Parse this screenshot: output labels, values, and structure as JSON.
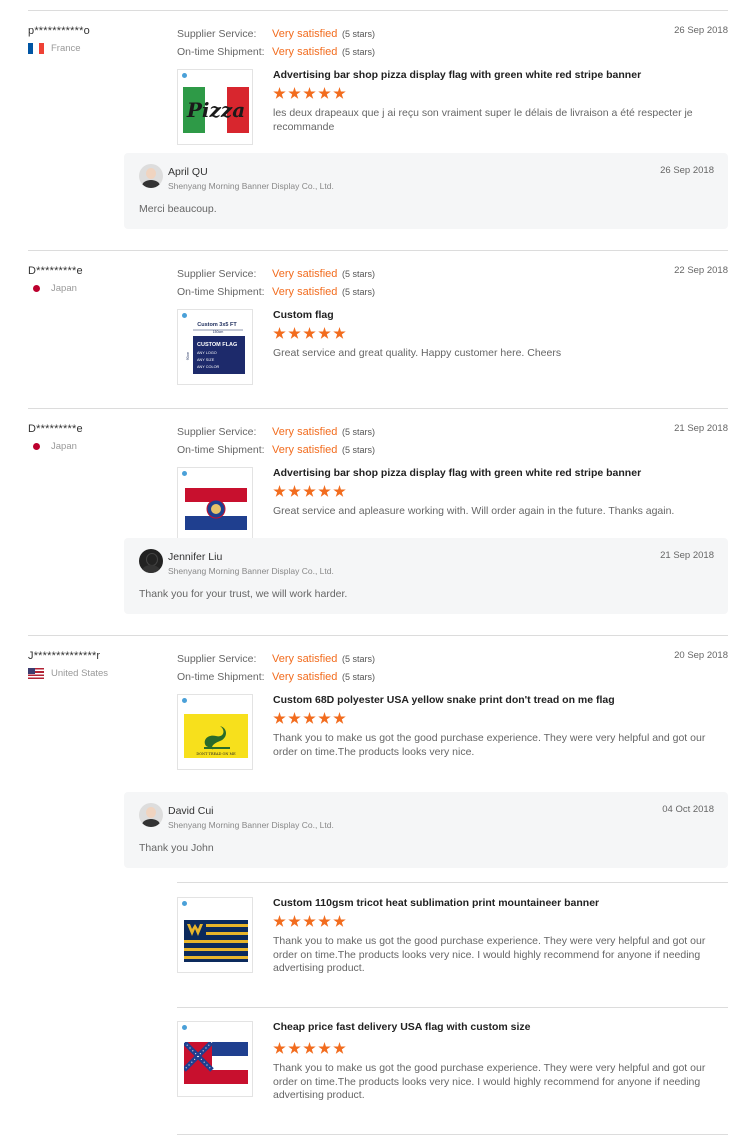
{
  "labels": {
    "supplier_service": "Supplier Service:",
    "ontime_shipment": "On-time Shipment:",
    "very_satisfied": "Very satisfied",
    "five_stars": "(5 stars)",
    "company": "Shenyang Morning Banner Display Co., Ltd."
  },
  "reviews": [
    {
      "buyer": "p***********o",
      "country": "France",
      "date": "26 Sep 2018",
      "products": [
        {
          "title": "Advertising bar shop pizza display flag with green white red stripe banner",
          "thumb_text": "Pizza",
          "rating": 5,
          "comment": "les deux drapeaux que j ai reçu son vraiment super le délais de livraison a été respecter je recommande"
        }
      ],
      "reply": {
        "name": "April QU",
        "date": "26 Sep 2018",
        "text": "Merci beaucoup."
      }
    },
    {
      "buyer": "D*********e",
      "country": "Japan",
      "date": "22 Sep 2018",
      "products": [
        {
          "title": "Custom flag",
          "thumb_text": [
            "Custom 3x5 FT",
            "150cm",
            "90cm",
            "CUSTOM FLAG",
            "ANY LOGO",
            "ANY SIZE",
            "ANY COLOR"
          ],
          "rating": 5,
          "comment": "Great service and great quality. Happy customer here. Cheers"
        }
      ]
    },
    {
      "buyer": "D*********e",
      "country": "Japan",
      "date": "21 Sep 2018",
      "products": [
        {
          "title": "Advertising bar shop pizza display flag with green white red stripe banner",
          "rating": 5,
          "comment": "Great service and apleasure working with. Will order again in the future. Thanks again."
        }
      ],
      "reply": {
        "name": "Jennifer Liu",
        "date": "21 Sep 2018",
        "text": "Thank you for your trust, we will work harder."
      }
    },
    {
      "buyer": "J**************r",
      "country": "United States",
      "date": "20 Sep 2018",
      "products": [
        {
          "title": "Custom 68D polyester USA yellow snake print don't tread on me flag",
          "thumb_text": "DONT TREAD ON ME",
          "rating": 5,
          "comment": "Thank you to make us got the good purchase experience. They were very helpful and got our order on time.The products looks very nice."
        },
        {
          "title": "Custom 110gsm tricot heat sublimation print mountaineer banner",
          "rating": 5,
          "comment": "Thank you to make us got the good purchase experience. They were very helpful and got our order on time.The products looks very nice. I would highly recommend for anyone if needing advertising product."
        },
        {
          "title": "Cheap price fast delivery USA flag with custom size",
          "rating": 5,
          "comment": "Thank you to make us got the good purchase experience. They were very helpful and got our order on time.The products looks very nice. I would highly recommend for anyone if needing advertising product."
        }
      ],
      "reply": {
        "name": "David Cui",
        "date": "04 Oct 2018",
        "text": "Thank you John"
      }
    }
  ]
}
